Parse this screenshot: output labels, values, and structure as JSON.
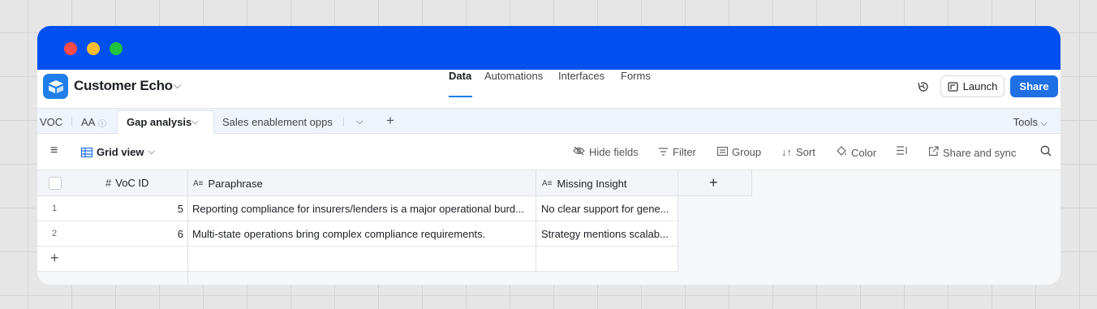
{
  "app": {
    "base_name": "Customer Echo",
    "nav": [
      "Data",
      "Automations",
      "Interfaces",
      "Forms"
    ],
    "launch_label": "Launch",
    "share_label": "Share"
  },
  "tabs": {
    "items": [
      "VOC",
      "AA",
      "Gap analysis",
      "Sales enablement opps"
    ],
    "tools_label": "Tools"
  },
  "viewbar": {
    "view_name": "Grid view",
    "hide_fields": "Hide fields",
    "filter": "Filter",
    "group": "Group",
    "sort": "Sort",
    "color": "Color",
    "share_sync": "Share and sync"
  },
  "table": {
    "columns": [
      "VoC ID",
      "Paraphrase",
      "Missing Insight"
    ],
    "rows": [
      {
        "num": "1",
        "voc_id": "5",
        "paraphrase": "Reporting compliance for insurers/lenders is a major operational burd...",
        "missing": "No clear support for gene..."
      },
      {
        "num": "2",
        "voc_id": "6",
        "paraphrase": "Multi-state operations bring complex compliance requirements.",
        "missing": "Strategy mentions scalab..."
      }
    ]
  }
}
